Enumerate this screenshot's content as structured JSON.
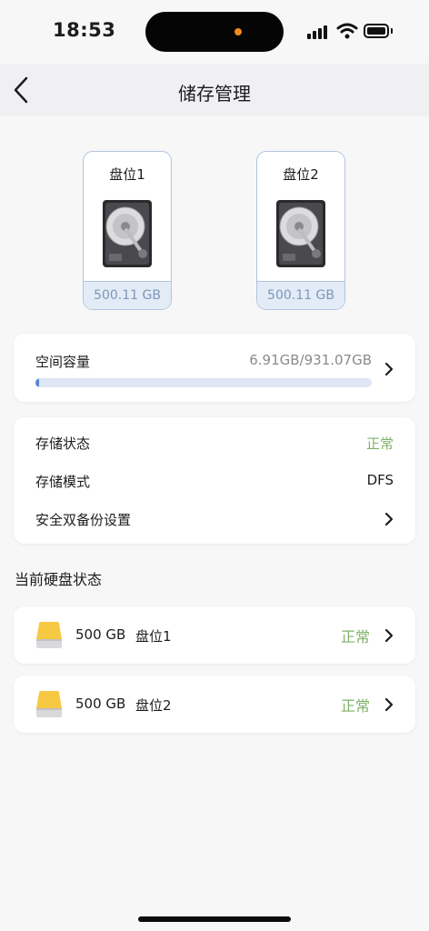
{
  "status_bar": {
    "time": "18:53"
  },
  "nav": {
    "title": "储存管理"
  },
  "bays": [
    {
      "label": "盘位1",
      "size": "500.11 GB"
    },
    {
      "label": "盘位2",
      "size": "500.11 GB"
    }
  ],
  "capacity": {
    "label": "空间容量",
    "value": "6.91GB/931.07GB",
    "used_fraction": 0.0074
  },
  "storage_info": {
    "status_label": "存储状态",
    "status_value": "正常",
    "mode_label": "存储模式",
    "mode_value": "DFS",
    "backup_label": "安全双备份设置"
  },
  "current_disks": {
    "title": "当前硬盘状态",
    "items": [
      {
        "size": "500 GB",
        "bay": "盘位1",
        "status": "正常"
      },
      {
        "size": "500 GB",
        "bay": "盘位2",
        "status": "正常"
      }
    ]
  },
  "colors": {
    "ok": "#7fb26a",
    "accent": "#5a86d6",
    "bay_border": "#b3c4de"
  }
}
